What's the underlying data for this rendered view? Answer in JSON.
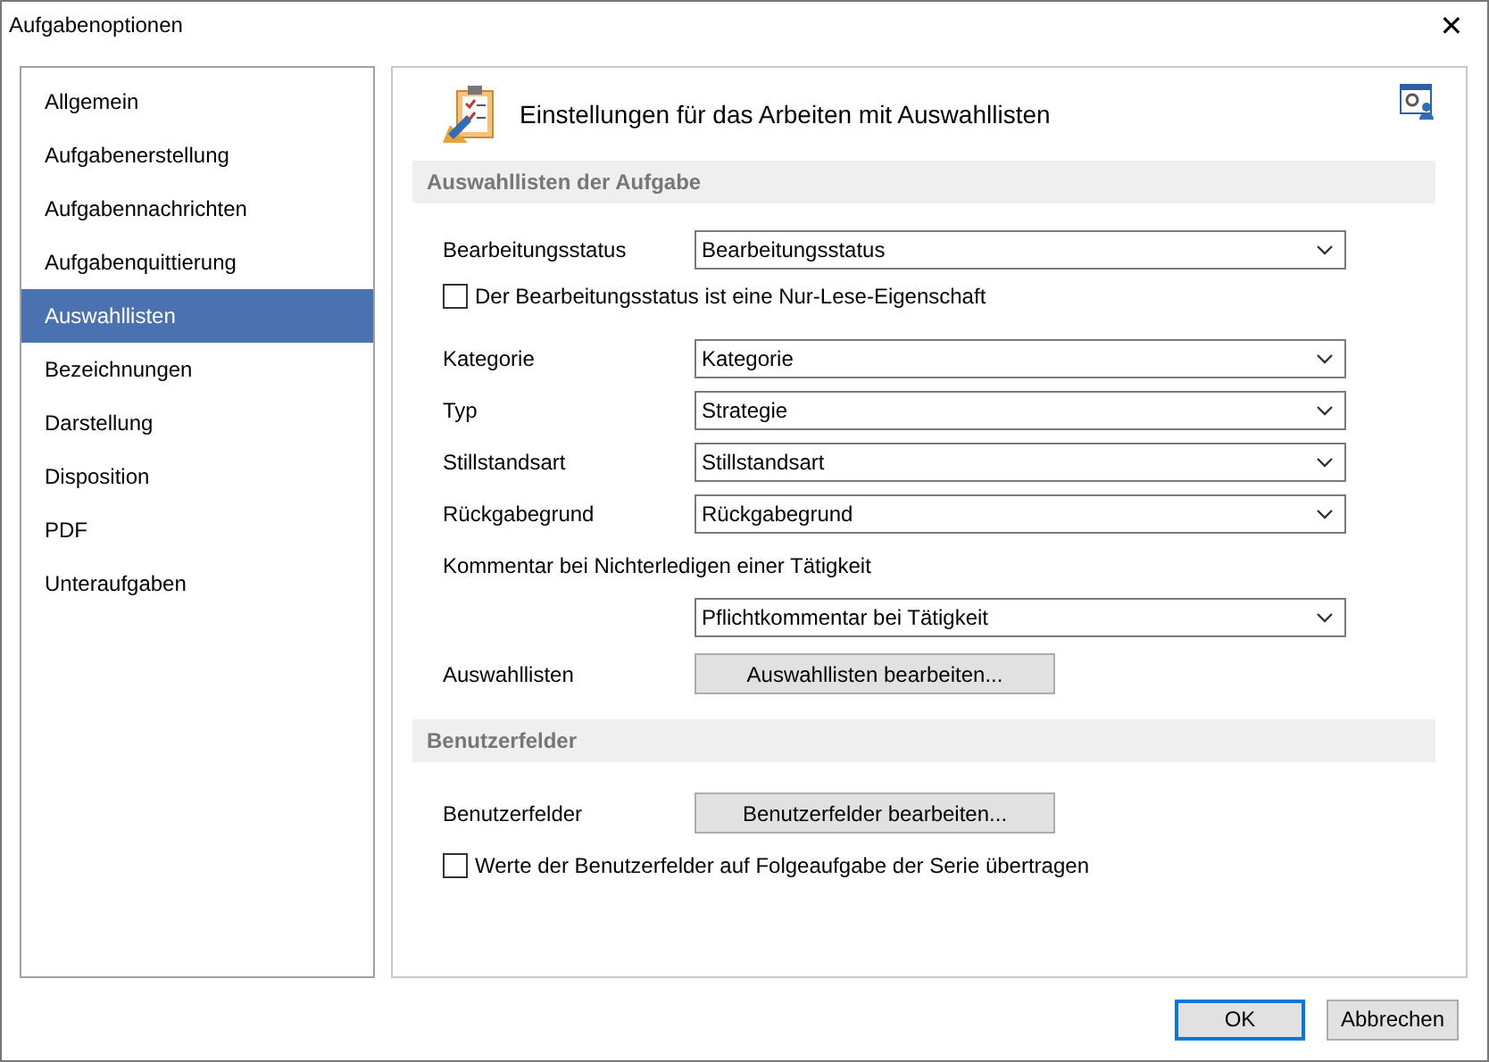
{
  "window": {
    "title": "Aufgabenoptionen",
    "close": "✕"
  },
  "sidebar": {
    "items": [
      {
        "label": "Allgemein",
        "selected": false
      },
      {
        "label": "Aufgabenerstellung",
        "selected": false
      },
      {
        "label": "Aufgabennachrichten",
        "selected": false
      },
      {
        "label": "Aufgabenquittierung",
        "selected": false
      },
      {
        "label": "Auswahllisten",
        "selected": true
      },
      {
        "label": "Bezeichnungen",
        "selected": false
      },
      {
        "label": "Darstellung",
        "selected": false
      },
      {
        "label": "Disposition",
        "selected": false
      },
      {
        "label": "PDF",
        "selected": false
      },
      {
        "label": "Unteraufgaben",
        "selected": false
      }
    ]
  },
  "panel": {
    "heading": "Einstellungen für das Arbeiten mit Auswahllisten",
    "sections": [
      {
        "title": "Auswahllisten der Aufgabe",
        "items": [
          {
            "kind": "select",
            "label": "Bearbeitungsstatus",
            "value": "Bearbeitungsstatus"
          },
          {
            "kind": "checkbox",
            "label": "Der Bearbeitungsstatus ist eine Nur-Lese-Eigenschaft",
            "checked": false
          },
          {
            "kind": "select",
            "label": "Kategorie",
            "value": "Kategorie"
          },
          {
            "kind": "select",
            "label": "Typ",
            "value": "Strategie"
          },
          {
            "kind": "select",
            "label": "Stillstandsart",
            "value": "Stillstandsart"
          },
          {
            "kind": "select",
            "label": "Rückgabegrund",
            "value": "Rückgabegrund"
          },
          {
            "kind": "note",
            "label": "Kommentar bei Nichterledigen einer Tätigkeit"
          },
          {
            "kind": "select",
            "value": "Pflichtkommentar bei Tätigkeit"
          },
          {
            "kind": "button",
            "label": "Auswahllisten",
            "button": "Auswahllisten bearbeiten..."
          }
        ]
      },
      {
        "title": "Benutzerfelder",
        "items": [
          {
            "kind": "button",
            "label": "Benutzerfelder",
            "button": "Benutzerfelder bearbeiten..."
          },
          {
            "kind": "checkbox",
            "label": "Werte der Benutzerfelder auf Folgeaufgabe der Serie übertragen",
            "checked": false
          }
        ]
      }
    ]
  },
  "buttons": [
    {
      "label": "OK",
      "default": true
    },
    {
      "label": "Abbrechen",
      "default": false
    }
  ]
}
